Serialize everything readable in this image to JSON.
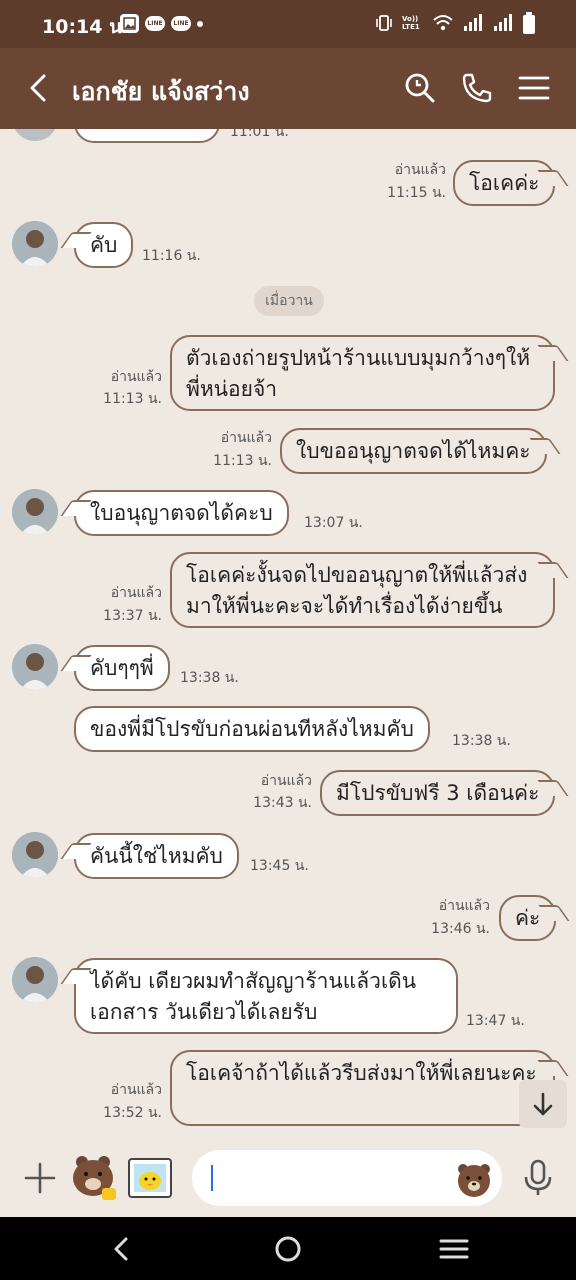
{
  "status_bar": {
    "time": "10:14 น.",
    "left_icons": [
      "gallery-icon",
      "line-icon",
      "line-icon",
      "dot-icon"
    ],
    "right_icons": [
      "vibrate-icon",
      "volte-icon",
      "wifi-icon",
      "signal-icon",
      "signal-icon",
      "battery-icon"
    ],
    "line_label": "LINE",
    "volte_label": "Vo)) LTE1"
  },
  "header": {
    "title": "เอกชัย แจ้งสว่าง",
    "icons": [
      "back-arrow-icon",
      "search-icon",
      "phone-icon",
      "menu-icon"
    ]
  },
  "chat": {
    "partial_top": {
      "time": "11:01 น."
    },
    "messages": [
      {
        "side": "out",
        "text": "โอเคค่ะ",
        "read": "อ่านแล้ว",
        "time": "11:15 น."
      },
      {
        "side": "in",
        "text": "คับ",
        "time": "11:16 น."
      },
      {
        "side": "date",
        "text": "เมื่อวาน"
      },
      {
        "side": "out",
        "text": "ตัวเองถ่ายรูปหน้าร้านแบบมุมกว้างๆให้พี่หน่อยจ้า",
        "read": "อ่านแล้ว",
        "time": "11:13 น."
      },
      {
        "side": "out",
        "text": "ใบขออนุญาตจดได้ไหมคะ",
        "read": "อ่านแล้ว",
        "time": "11:13 น."
      },
      {
        "side": "in",
        "text": "ใบอนุญาตจดได้คะบ",
        "time": "13:07 น."
      },
      {
        "side": "out",
        "text": "โอเคค่ะงั้นจดไปขออนุญาตให้พี่แล้วส่งมาให้พี่นะคะจะได้ทำเรื่องได้ง่ายขึ้น",
        "read": "อ่านแล้ว",
        "time": "13:37 น."
      },
      {
        "side": "in",
        "text": "คับๆๆพี่",
        "time": "13:38 น."
      },
      {
        "side": "in",
        "text": "ของพี่มีโปรขับก่อนผ่อนทีหลังไหมคับ",
        "time": "13:38 น."
      },
      {
        "side": "out",
        "text": "มีโปรขับฟรี 3 เดือนค่ะ",
        "read": "อ่านแล้ว",
        "time": "13:43 น."
      },
      {
        "side": "in",
        "text": "คันนี้ใช่ไหมคับ",
        "time": "13:45 น."
      },
      {
        "side": "out",
        "text": "ค่ะ",
        "read": "อ่านแล้ว",
        "time": "13:46 น."
      },
      {
        "side": "in",
        "text": "ได้คับ  เดียวผมทำสัญญาร้านแล้วเดินเอกสาร วันเดียวได้เลยรับ",
        "time": "13:47 น."
      },
      {
        "side": "out",
        "text": "โอเคจ้าถ้าได้แล้วรีบส่งมาให้พี่เลยนะคะ",
        "read": "อ่านแล้ว",
        "time": "13:52 น."
      }
    ]
  },
  "input_bar": {
    "value": "",
    "icons": [
      "plus-icon",
      "brown-bear-sticker-icon",
      "photo-icon",
      "emoji-bear-icon",
      "mic-icon"
    ]
  },
  "nav_bar": {
    "icons": [
      "nav-back-icon",
      "nav-home-icon",
      "nav-recents-icon"
    ]
  },
  "colors": {
    "status_bar": "#5d3c2b",
    "header": "#6b4634",
    "chat_bg": "#efe9e2",
    "bubble_border": "#8a6e5c",
    "caret": "#2a6de0"
  }
}
